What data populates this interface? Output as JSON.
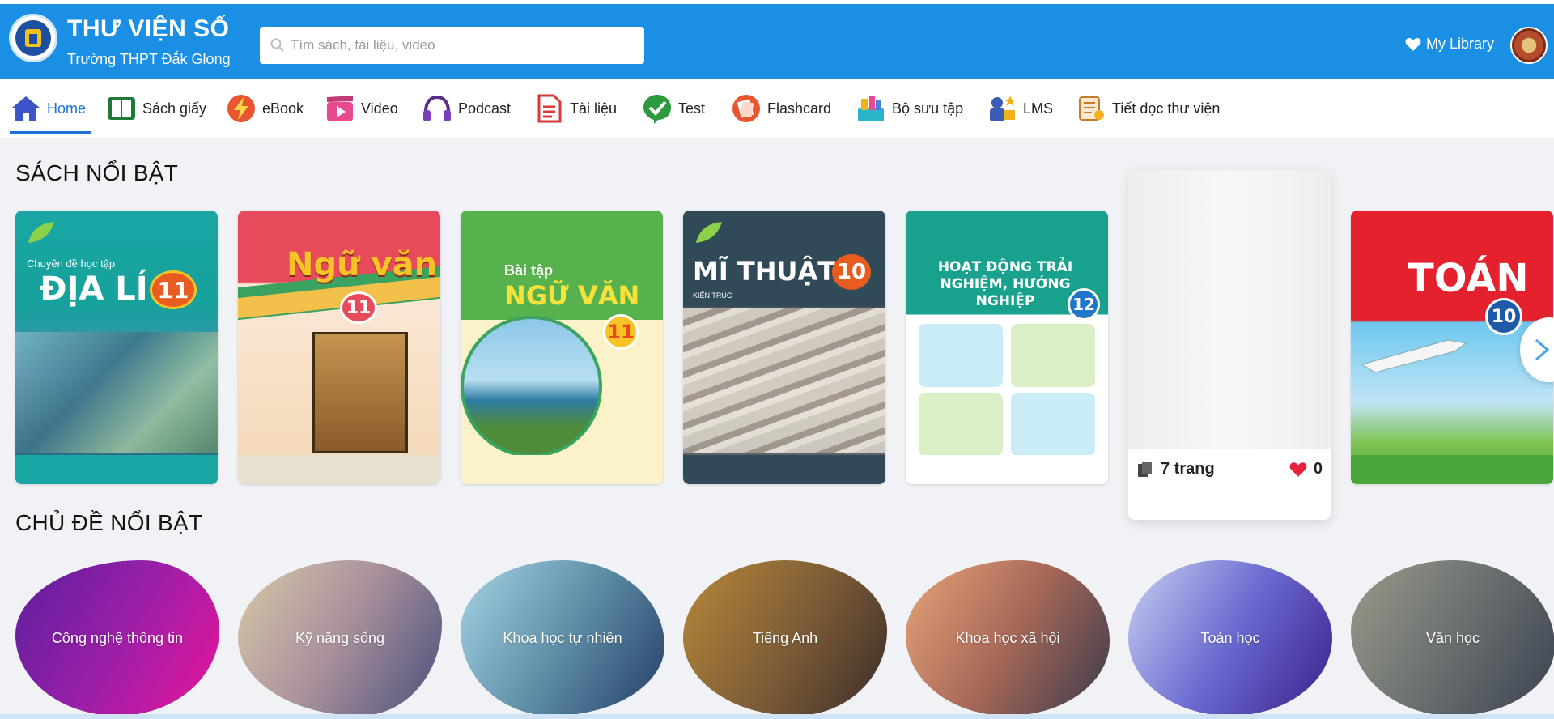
{
  "header": {
    "title": "THƯ VIỆN SỐ",
    "subtitle": "Trường THPT Đắk Glong",
    "search_placeholder": "Tìm sách, tài liệu, video",
    "my_library": "My Library"
  },
  "nav": [
    {
      "label": "Home",
      "icon": "home-icon"
    },
    {
      "label": "Sách giấy",
      "icon": "book-icon"
    },
    {
      "label": "eBook",
      "icon": "lightning-icon"
    },
    {
      "label": "Video",
      "icon": "video-icon"
    },
    {
      "label": "Podcast",
      "icon": "headphones-icon"
    },
    {
      "label": "Tài liệu",
      "icon": "document-icon"
    },
    {
      "label": "Test",
      "icon": "test-icon"
    },
    {
      "label": "Flashcard",
      "icon": "flashcard-icon"
    },
    {
      "label": "Bộ sưu tập",
      "icon": "collection-icon"
    },
    {
      "label": "LMS",
      "icon": "lms-icon"
    },
    {
      "label": "Tiết đọc thư viện",
      "icon": "reading-icon"
    }
  ],
  "featured_books": {
    "title": "SÁCH NỔI BẬT",
    "books": [
      {
        "subtitle": "Chuyên đề học tập",
        "title": "ĐỊA LÍ",
        "grade": "11"
      },
      {
        "subtitle": "",
        "title": "Ngữ văn",
        "grade": "11"
      },
      {
        "subtitle": "Bài tập",
        "title": "NGỮ VĂN",
        "grade": "11"
      },
      {
        "subtitle": "KIẾN TRÚC",
        "title": "MĨ THUẬT",
        "grade": "10"
      },
      {
        "subtitle": "",
        "title": "HOẠT ĐỘNG TRẢI NGHIỆM, HƯỚNG NGHIỆP",
        "grade": "12"
      },
      {
        "subtitle": "",
        "title": "TOÁN",
        "grade": "10"
      }
    ],
    "hover_card": {
      "pages": "7 trang",
      "likes": "0"
    }
  },
  "featured_topics": {
    "title": "CHỦ ĐỀ NỔI BẬT",
    "topics": [
      "Công nghệ thông tin",
      "Kỹ năng sống",
      "Khoa học tự nhiên",
      "Tiếng Anh",
      "Khoa học xã hội",
      "Toán học",
      "Văn học"
    ]
  }
}
